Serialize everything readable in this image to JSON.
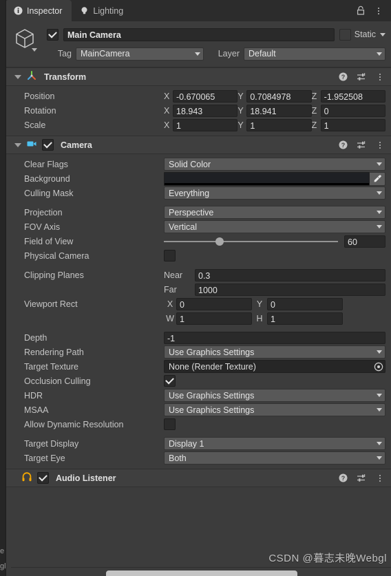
{
  "window": {
    "tabs": [
      {
        "label": "Inspector",
        "icon": "info-icon",
        "active": true
      },
      {
        "label": "Lighting",
        "icon": "lightbulb-icon",
        "active": false
      }
    ],
    "lock_icon": "lock-icon",
    "menu_icon": "kebab-menu-icon"
  },
  "object": {
    "icon": "gameobject-cube-icon",
    "enabled": true,
    "name": "Main Camera",
    "static_label": "Static",
    "static_checked": false,
    "tag_label": "Tag",
    "tag_value": "MainCamera",
    "layer_label": "Layer",
    "layer_value": "Default"
  },
  "components": [
    {
      "title": "Transform",
      "icon": "transform-gizmo-icon",
      "has_enable_toggle": false,
      "expanded": true,
      "rows": [
        {
          "label": "Position",
          "type": "vector3",
          "axes": [
            "X",
            "Y",
            "Z"
          ],
          "values": [
            "-0.670065",
            "0.7084978",
            "-1.952508"
          ]
        },
        {
          "label": "Rotation",
          "type": "vector3",
          "axes": [
            "X",
            "Y",
            "Z"
          ],
          "values": [
            "18.943",
            "18.941",
            "0"
          ]
        },
        {
          "label": "Scale",
          "type": "vector3",
          "axes": [
            "X",
            "Y",
            "Z"
          ],
          "values": [
            "1",
            "1",
            "1"
          ]
        }
      ]
    },
    {
      "title": "Camera",
      "icon": "camera-icon",
      "has_enable_toggle": true,
      "enabled": true,
      "expanded": true,
      "rows": [
        {
          "label": "Clear Flags",
          "type": "dropdown",
          "value": "Solid Color"
        },
        {
          "label": "Background",
          "type": "color",
          "color": "#1e2024",
          "alpha_color": "#000000"
        },
        {
          "label": "Culling Mask",
          "type": "dropdown",
          "value": "Everything"
        },
        {
          "label": "",
          "type": "spacer"
        },
        {
          "label": "Projection",
          "type": "dropdown",
          "value": "Perspective"
        },
        {
          "label": "FOV Axis",
          "type": "dropdown",
          "value": "Vertical"
        },
        {
          "label": "Field of View",
          "type": "slider",
          "value": "60",
          "slider_percent": 32
        },
        {
          "label": "Physical Camera",
          "type": "checkbox",
          "checked": false
        },
        {
          "label": "",
          "type": "spacer"
        },
        {
          "label": "Clipping Planes",
          "type": "named_number",
          "sub_label": "Near",
          "value": "0.3"
        },
        {
          "label": "",
          "type": "named_number",
          "sub_label": "Far",
          "value": "1000"
        },
        {
          "label": "Viewport Rect",
          "type": "pair",
          "axes": [
            "X",
            "Y"
          ],
          "values": [
            "0",
            "0"
          ]
        },
        {
          "label": "",
          "type": "pair",
          "axes": [
            "W",
            "H"
          ],
          "values": [
            "1",
            "1"
          ]
        },
        {
          "label": "",
          "type": "spacer"
        },
        {
          "label": "Depth",
          "type": "number",
          "value": "-1"
        },
        {
          "label": "Rendering Path",
          "type": "dropdown",
          "value": "Use Graphics Settings"
        },
        {
          "label": "Target Texture",
          "type": "object",
          "value": "None (Render Texture)"
        },
        {
          "label": "Occlusion Culling",
          "type": "checkbox",
          "checked": true
        },
        {
          "label": "HDR",
          "type": "dropdown",
          "value": "Use Graphics Settings"
        },
        {
          "label": "MSAA",
          "type": "dropdown",
          "value": "Use Graphics Settings"
        },
        {
          "label": "Allow Dynamic Resolution",
          "type": "checkbox",
          "checked": false
        },
        {
          "label": "",
          "type": "spacer"
        },
        {
          "label": "Target Display",
          "type": "dropdown",
          "value": "Display 1"
        },
        {
          "label": "Target Eye",
          "type": "dropdown",
          "value": "Both"
        }
      ]
    },
    {
      "title": "Audio Listener",
      "icon": "headphones-icon",
      "has_enable_toggle": true,
      "enabled": true,
      "expanded": false,
      "rows": []
    }
  ],
  "component_tools": {
    "help": "help-icon",
    "preset": "preset-settings-icon",
    "menu": "kebab-menu-icon"
  },
  "watermark": "CSDN @暮志未晚Webgl",
  "left_sliver": {
    "ghost_top": "e",
    "ghost_bottom": "gl"
  },
  "colors": {
    "panel_bg": "#3c3c3c",
    "header_bg": "#3f3f3f",
    "field_bg": "#2a2a2a",
    "dropdown_bg": "#585858",
    "text": "#c5c5c5",
    "camera_icon": "#4ec1f0",
    "audio_icon": "#f5a800"
  }
}
